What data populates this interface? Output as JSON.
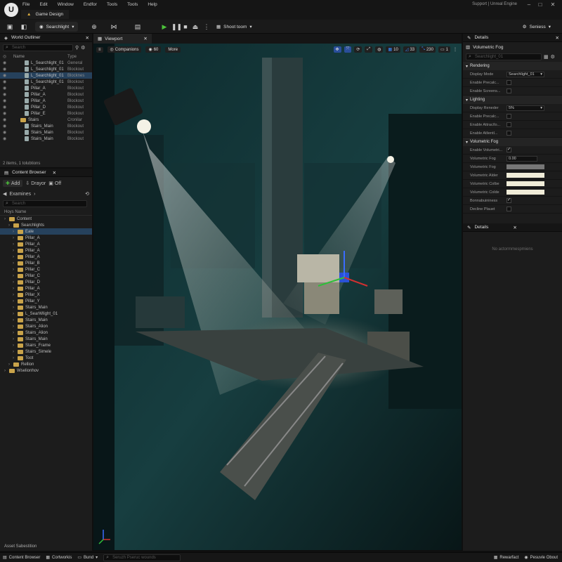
{
  "app": {
    "logo": "U",
    "menu": [
      "File",
      "Edit",
      "Window",
      "Endfor",
      "Tools",
      "Tools",
      "Help"
    ],
    "tab": "Game Design",
    "support": "Support | Unreal Engine"
  },
  "toolbar": {
    "mode_label": "Searchlight",
    "shoot_label": "Shoot toom",
    "settings_label": "Seniess"
  },
  "outliner": {
    "title": "World Outliner",
    "search_placeholder": "Search",
    "col_name": "Name",
    "col_type": "Type",
    "rows": [
      {
        "name": "L_Searchlight_01",
        "type": "General"
      },
      {
        "name": "L_Searchlight_01",
        "type": "Blockout"
      },
      {
        "name": "L_Searchlight_01",
        "type": "Blocknes"
      },
      {
        "name": "L_Searchlight_01",
        "type": "Blockout"
      },
      {
        "name": "Pillar_A",
        "type": "Blockout"
      },
      {
        "name": "Pillar_A",
        "type": "Blockout"
      },
      {
        "name": "Pillar_A",
        "type": "Blockout"
      },
      {
        "name": "Pillar_D",
        "type": "Blockout"
      },
      {
        "name": "Pillar_E",
        "type": "Blockout"
      },
      {
        "name": "Stairs",
        "type": "Cronilar"
      },
      {
        "name": "Stairs_Main",
        "type": "Blockout"
      },
      {
        "name": "Stairs_Main",
        "type": "Blockout"
      },
      {
        "name": "Stairs_Main",
        "type": "Blockout"
      }
    ],
    "footer": "2 items, 1 tolubtions"
  },
  "content": {
    "title": "Content Browser",
    "add_label": "Add",
    "import_label": "Drayor",
    "save_label": "Off",
    "examines_label": "Examines",
    "search_placeholder": "Search",
    "col_header": "Hoys Name",
    "tree": [
      {
        "name": "Content",
        "depth": 0
      },
      {
        "name": "Searchlights",
        "depth": 1
      },
      {
        "name": "Eale",
        "depth": 2
      },
      {
        "name": "Pillar_A",
        "depth": 2
      },
      {
        "name": "Pillar_A",
        "depth": 2
      },
      {
        "name": "Pillar_A",
        "depth": 2
      },
      {
        "name": "Pillar_A",
        "depth": 2
      },
      {
        "name": "Pillar_B",
        "depth": 2
      },
      {
        "name": "Pillar_C",
        "depth": 2
      },
      {
        "name": "Pillar_C",
        "depth": 2
      },
      {
        "name": "Pillar_D",
        "depth": 2
      },
      {
        "name": "Pillar_A",
        "depth": 2
      },
      {
        "name": "Pillar_X",
        "depth": 2
      },
      {
        "name": "Pillar_Y",
        "depth": 2
      },
      {
        "name": "Stairs_Main",
        "depth": 2
      },
      {
        "name": "L_SearWlight_01",
        "depth": 2
      },
      {
        "name": "Stairs_Main",
        "depth": 2
      },
      {
        "name": "Stairs_Alion",
        "depth": 2
      },
      {
        "name": "Stairs_Alion",
        "depth": 2
      },
      {
        "name": "Stairs_Main",
        "depth": 2
      },
      {
        "name": "Stairs_Frame",
        "depth": 2
      },
      {
        "name": "Stairs_Simele",
        "depth": 2
      },
      {
        "name": "Toot",
        "depth": 2
      },
      {
        "name": "Rellion",
        "depth": 1
      },
      {
        "name": "Wselionhov",
        "depth": 0
      }
    ],
    "footer": "Asset Sabestition"
  },
  "viewport": {
    "tab": "Viewport",
    "companions": "Companions",
    "fps": "60",
    "more": "More",
    "stat_a": "10",
    "stat_b": "33",
    "stat_c": "230",
    "stat_d": "1"
  },
  "details": {
    "title": "Details",
    "object": "Volumetric Fog",
    "search_placeholder": "Searchlight_01",
    "sections": {
      "rendering": "Rendering",
      "lighting": "Lighting",
      "volumetric": "Volumetric Fog"
    },
    "rendering_rows": [
      {
        "label": "Display Mode",
        "value": "Searchlight_01"
      },
      {
        "label": "Enable Precalc...",
        "value": ""
      },
      {
        "label": "Enable Screens...",
        "value": ""
      }
    ],
    "lighting_rows": [
      {
        "label": "Display Reneder",
        "value": "5%"
      },
      {
        "label": "Enable Precalc...",
        "value": ""
      },
      {
        "label": "Enable Attrac/lo...",
        "value": ""
      },
      {
        "label": "Enable Atlientl...",
        "value": ""
      }
    ],
    "volumetric_rows": [
      {
        "label": "Enable Volumetri...",
        "value": ""
      },
      {
        "label": "Volumetric Fog",
        "value": "0.00"
      },
      {
        "label": "Volumetric Fog",
        "value": ""
      },
      {
        "label": "Volumetric Alder",
        "value": ""
      },
      {
        "label": "Volumetric Colbe",
        "value": ""
      },
      {
        "label": "Volumetric Colde",
        "value": ""
      },
      {
        "label": "Bonnabuininess",
        "value": ""
      },
      {
        "label": "Decline Plauet",
        "value": ""
      }
    ],
    "second_title": "Details",
    "empty_text": "No actormmespmiens"
  },
  "status": {
    "content_browser": "Content Browser",
    "cortworkis": "Cortworkis",
    "build": "Bund",
    "console_placeholder": "Seruzh Pseruc wounds",
    "rewarfact": "Rewarfact",
    "pesuvie": "Pesuvle Obout"
  }
}
